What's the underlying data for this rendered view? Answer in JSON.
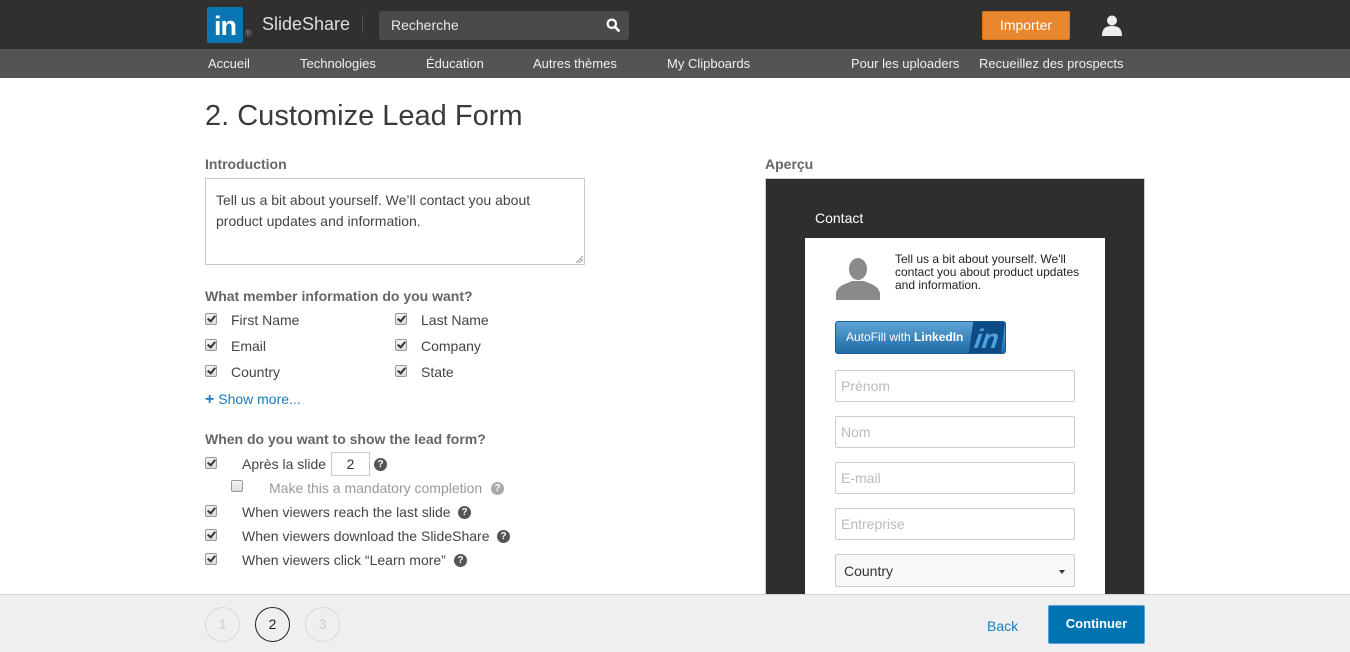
{
  "header": {
    "logo_text": "in",
    "logo_reg": "®",
    "brand": "SlideShare",
    "search_placeholder": "Recherche",
    "import_label": "Importer",
    "accent_color": "#e8872d"
  },
  "nav": {
    "items": [
      {
        "label": "Accueil"
      },
      {
        "label": "Technologies"
      },
      {
        "label": "Éducation"
      },
      {
        "label": "Autres thèmes"
      },
      {
        "label": "My Clipboards"
      },
      {
        "label": "Pour les uploaders"
      },
      {
        "label": "Recueillez des prospects"
      }
    ]
  },
  "page": {
    "title": "2. Customize Lead Form"
  },
  "form": {
    "intro_label": "Introduction",
    "intro_text": "Tell us a bit about yourself. We’ll contact you about product updates and information.",
    "member_info_label": "What member information do you want?",
    "fields": [
      {
        "label": "First Name",
        "checked": true
      },
      {
        "label": "Last Name",
        "checked": true
      },
      {
        "label": "Email",
        "checked": true
      },
      {
        "label": "Company",
        "checked": true
      },
      {
        "label": "Country",
        "checked": true
      },
      {
        "label": "State",
        "checked": true
      }
    ],
    "show_more_plus": "+",
    "show_more_label": "Show more...",
    "when_label": "When do you want to show the lead form?",
    "after_slide_label": "Après la slide",
    "after_slide_value": "2",
    "after_slide_checked": true,
    "mandatory_label": "Make this a mandatory completion",
    "mandatory_checked": false,
    "triggers": [
      {
        "label": "When viewers reach the last slide",
        "checked": true
      },
      {
        "label": "When viewers download the SlideShare",
        "checked": true
      },
      {
        "label": "When viewers click “Learn more”",
        "checked": true
      }
    ],
    "help_glyph": "?"
  },
  "preview": {
    "label": "Aperçu",
    "title": "Contact",
    "intro_text": "Tell us a bit about yourself. We'll contact you about product updates and information.",
    "autofill_label_1": "AutoFill with ",
    "autofill_label_2": "LinkedIn",
    "autofill_logo": "in",
    "inputs": [
      {
        "placeholder": "Prénom"
      },
      {
        "placeholder": "Nom"
      },
      {
        "placeholder": "E-mail"
      },
      {
        "placeholder": "Entreprise"
      }
    ],
    "country_select": "Country"
  },
  "footer": {
    "steps": [
      {
        "label": "1",
        "active": false
      },
      {
        "label": "2",
        "active": true
      },
      {
        "label": "3",
        "active": false
      }
    ],
    "back_label": "Back",
    "continue_label": "Continuer",
    "primary_color": "#0074b0"
  }
}
